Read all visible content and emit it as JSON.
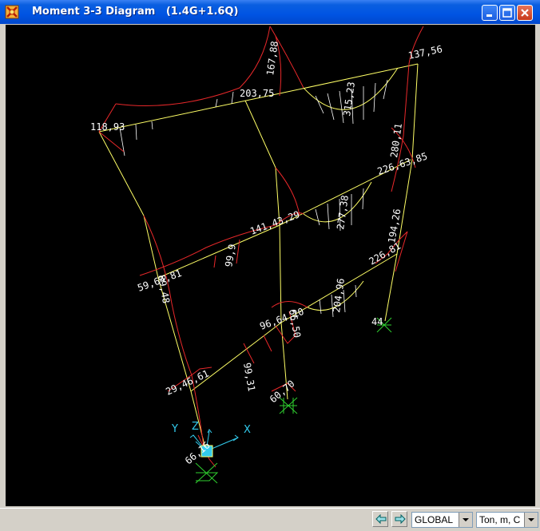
{
  "window": {
    "title": "Moment 3-3 Diagram   (1.4G+1.6Q)"
  },
  "toolbar": {
    "minimize": "minimize",
    "maximize": "maximize",
    "close": "close"
  },
  "diagram": {
    "labels": {
      "top_left": "118,93",
      "top_mid": "203,75",
      "top_right": "137,56",
      "top_vertical": "167,88",
      "top_span": "315,23",
      "col_right_top": "280,11",
      "mid_right": "226,63,85",
      "mid_span": "277,38",
      "mid_center": "141,43,29",
      "mid_left": "59,64,81",
      "mid_left_col": "89,48",
      "mid_span2": "99,9",
      "low_right_col": "194,26",
      "low_right": "226,81",
      "low_span": "204,96",
      "low_center": "96,64,10",
      "low_col": "66,50",
      "low_span2": "99,31",
      "base_left": "29,46,61",
      "base_mid": "60,70",
      "base_left_support": "66,16",
      "right_support": "44"
    },
    "axes": {
      "x": "X",
      "y": "Y",
      "z": "Z"
    },
    "colors": {
      "background": "#000000",
      "frame": "#ffff66",
      "moment": "#e8282a",
      "support": "#2fd02f",
      "axis": "#33ccee",
      "label": "#ffffff"
    }
  },
  "status": {
    "nav_left_icon": "arrow-left-icon",
    "nav_right_icon": "arrow-right-icon",
    "coord_system": "GLOBAL",
    "units": "Ton, m, C"
  }
}
